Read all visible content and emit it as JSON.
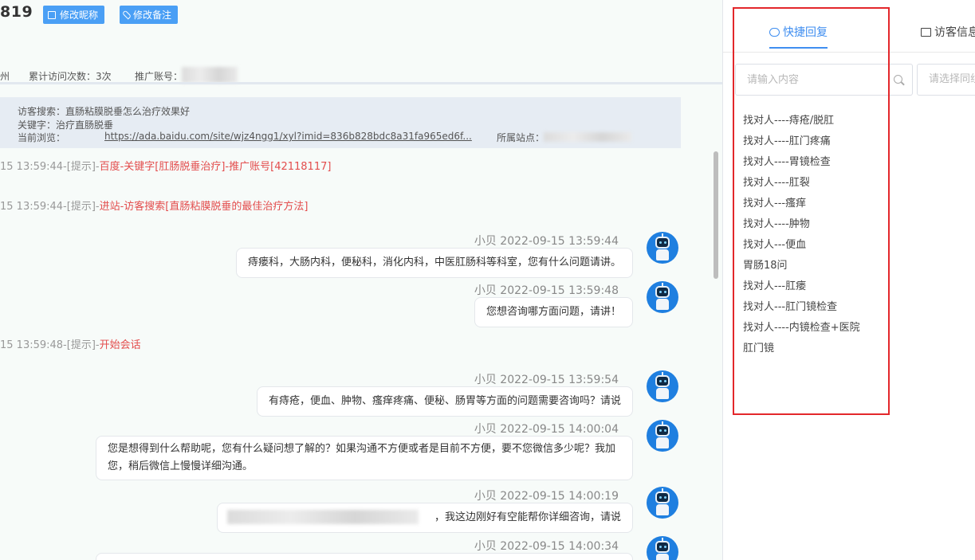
{
  "header": {
    "visitor_id": "819",
    "edit_nickname_label": "修改昵称",
    "edit_note_label": "修改备注"
  },
  "stats": {
    "location_fragment": "州",
    "visit_count": "累计访问次数：3次",
    "promo_account_label": "推广账号："
  },
  "info": {
    "search_line": "访客搜索：直肠粘膜脱垂怎么治疗效果好",
    "keyword_line": "关键字：治疗直肠脱垂",
    "browsing_label": "当前浏览：",
    "browsing_url": "https://ada.baidu.com/site/wjz4ngg1/xyl?imid=836b828bdc8a31fa965ed6f...",
    "site_label": "所属站点："
  },
  "system_messages": [
    {
      "prefix": "15 13:59:44-[提示]-",
      "text": "百度-关键字[肛肠脱垂治疗]-推广账号[42118117]"
    },
    {
      "prefix": "15 13:59:44-[提示]-",
      "text": "进站-访客搜索[直肠粘膜脱垂的最佳治疗方法]"
    },
    {
      "prefix": "15 13:59:48-[提示]-",
      "text": "开始会话"
    }
  ],
  "messages": [
    {
      "meta": "小贝 2022-09-15 13:59:44",
      "text": "痔瘘科，大肠内科，便秘科，消化内科，中医肛肠科等科室，您有什么问题请讲。"
    },
    {
      "meta": "小贝 2022-09-15 13:59:48",
      "text": "您想咨询哪方面问题，请讲！"
    },
    {
      "meta": "小贝 2022-09-15 13:59:54",
      "text": "有痔疮，便血、肿物、瘙痒疼痛、便秘、肠胃等方面的问题需要咨询吗？请说"
    },
    {
      "meta": "小贝 2022-09-15 14:00:04",
      "text": "您是想得到什么帮助呢，您有什么疑问想了解的？如果沟通不方便或者是目前不方便，要不您微信多少呢？我加您，稍后微信上慢慢详细沟通。"
    },
    {
      "meta": "小贝 2022-09-15 14:00:19",
      "text": "，我这边刚好有空能帮你详细咨询，请说"
    },
    {
      "meta": "小贝 2022-09-15 14:00:34",
      "text": ""
    }
  ],
  "right_panel": {
    "tabs": [
      {
        "label": "快捷回复",
        "active": true
      },
      {
        "label": "访客信息",
        "active": false
      }
    ],
    "search_placeholder": "请输入内容",
    "select_placeholder": "请选择同组",
    "quick_replies": [
      "找对人----痔疮/脱肛",
      "找对人----肛门疼痛",
      "找对人----胃镜检查",
      "找对人----肛裂",
      "找对人---瘙痒",
      "找对人----肿物",
      "找对人---便血",
      "胃肠18问",
      "找对人---肛瘘",
      "找对人---肛门镜检查",
      "找对人----内镜检查+医院",
      "肛门镜"
    ]
  },
  "colors": {
    "accent": "#3f8ef0",
    "button": "#4a9ff5",
    "system_red": "#e34d4d",
    "highlight_box": "#e3272b"
  }
}
